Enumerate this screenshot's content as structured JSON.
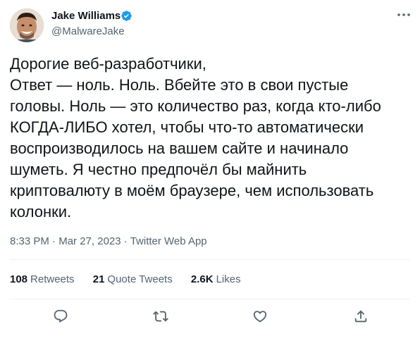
{
  "author": {
    "display_name": "Jake Williams",
    "handle": "@MalwareJake",
    "verified": true
  },
  "tweet": {
    "lines": [
      "Дорогие веб-разработчики,",
      "Ответ — ноль. Ноль. Вбейте это в свои пустые",
      "головы. Ноль — это количество раз, когда кто-либо",
      "КОГДА-ЛИБО хотел, чтобы что-то автоматически",
      "воспроизводилось на вашем сайте и начинало",
      "шуметь. Я честно предпочёл бы майнить",
      "криптовалюту в моём браузере, чем использовать",
      "колонки."
    ],
    "time": "8:33 PM",
    "date": "Mar 27, 2023",
    "separator": "·",
    "source": "Twitter Web App"
  },
  "stats": {
    "retweets": {
      "value": "108",
      "label": "Retweets"
    },
    "quotes": {
      "value": "21",
      "label": "Quote Tweets"
    },
    "likes": {
      "value": "2.6K",
      "label": "Likes"
    }
  },
  "icons": {
    "more": "more-horizontal-icon",
    "verified": "verified-badge-icon",
    "reply": "reply-icon",
    "retweet": "retweet-icon",
    "like": "heart-icon",
    "share": "share-icon"
  },
  "colors": {
    "text": "#0f1419",
    "secondary": "#536471",
    "verified": "#1d9bf0",
    "divider": "#eff3f4"
  }
}
